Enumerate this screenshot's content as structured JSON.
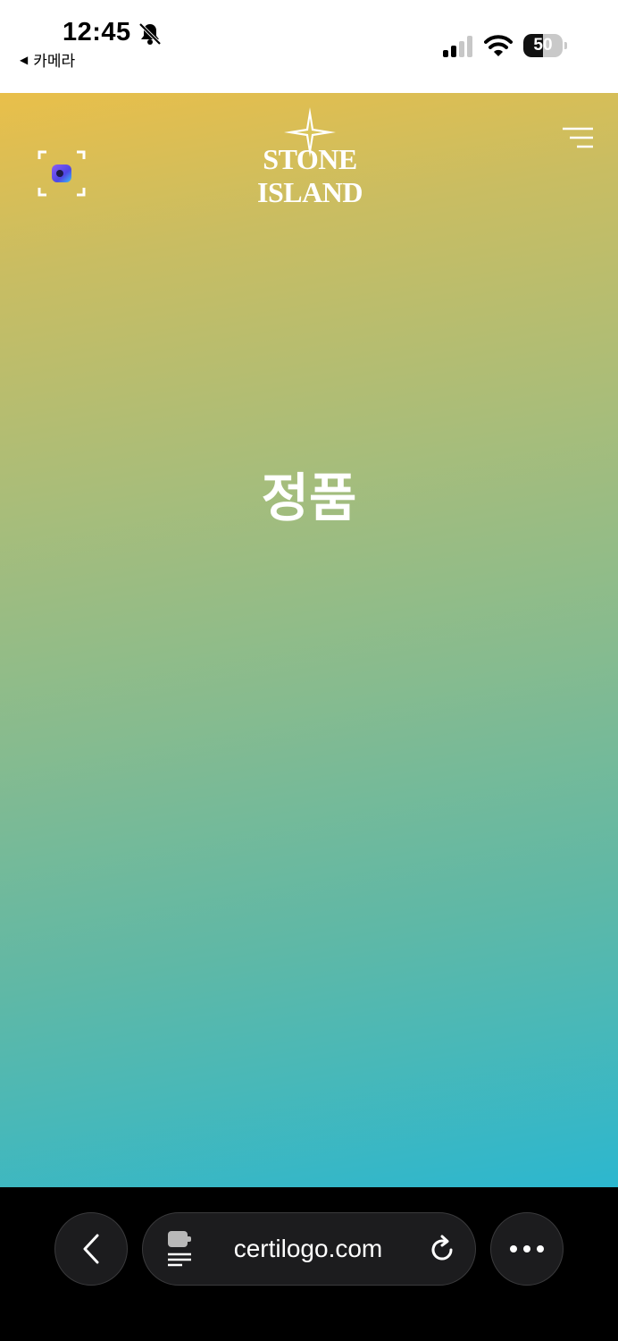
{
  "status_bar": {
    "time": "12:45",
    "back_app_label": "카메라",
    "battery_level": "50",
    "icons": [
      "bell-slash-icon",
      "signal-icon",
      "wifi-icon",
      "battery-icon"
    ]
  },
  "header": {
    "brand": "STONE ISLAND",
    "icons": [
      "scan-icon",
      "compass-rose-logo",
      "menu-icon"
    ]
  },
  "main": {
    "headline": "정품"
  },
  "browser": {
    "url": "certilogo.com",
    "icons": [
      "back-chevron-icon",
      "page-icon",
      "reload-icon",
      "more-icon"
    ]
  },
  "colors": {
    "gradient_top": "#e9bf4a",
    "gradient_bottom": "#2cb7cf",
    "bar_background": "#000000",
    "button_background": "#1c1c1e"
  }
}
